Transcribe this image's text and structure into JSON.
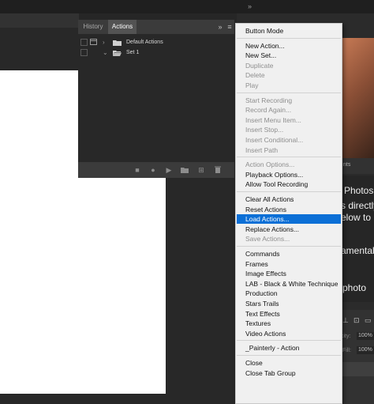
{
  "workspace": {
    "top_arrow": "»",
    "panel_bits": {
      "tab_fragment": "nts",
      "photos_text": "Photosh",
      "directly_text": "s directly",
      "below_text": "elow to b",
      "fundamental_text": "amental",
      "photo_text": "photo",
      "opacity_label": "city:",
      "opacity_value": "100%",
      "fill_label": "Fill:",
      "fill_value": "100%"
    }
  },
  "actions_panel": {
    "tabs": {
      "history": "History",
      "actions": "Actions"
    },
    "header_icons": {
      "collapse": "»",
      "menu": "≡"
    },
    "rows": [
      {
        "label": "Default Actions",
        "expanded": false
      },
      {
        "label": "Set 1",
        "expanded": true
      }
    ],
    "footer_icons": [
      "stop-icon",
      "record-icon",
      "play-icon",
      "folder-icon",
      "new-action-icon",
      "trash-icon"
    ]
  },
  "menu": {
    "groups": [
      [
        {
          "label": "Button Mode",
          "enabled": true
        }
      ],
      [
        {
          "label": "New Action...",
          "enabled": true
        },
        {
          "label": "New Set...",
          "enabled": true
        },
        {
          "label": "Duplicate",
          "enabled": false
        },
        {
          "label": "Delete",
          "enabled": false
        },
        {
          "label": "Play",
          "enabled": false
        }
      ],
      [
        {
          "label": "Start Recording",
          "enabled": false
        },
        {
          "label": "Record Again...",
          "enabled": false
        },
        {
          "label": "Insert Menu Item...",
          "enabled": false
        },
        {
          "label": "Insert Stop...",
          "enabled": false
        },
        {
          "label": "Insert Conditional...",
          "enabled": false
        },
        {
          "label": "Insert Path",
          "enabled": false
        }
      ],
      [
        {
          "label": "Action Options...",
          "enabled": false
        },
        {
          "label": "Playback Options...",
          "enabled": true
        },
        {
          "label": "Allow Tool Recording",
          "enabled": true
        }
      ],
      [
        {
          "label": "Clear All Actions",
          "enabled": true
        },
        {
          "label": "Reset Actions",
          "enabled": true
        },
        {
          "label": "Load Actions...",
          "enabled": true,
          "selected": true
        },
        {
          "label": "Replace Actions...",
          "enabled": true
        },
        {
          "label": "Save Actions...",
          "enabled": false
        }
      ],
      [
        {
          "label": "Commands",
          "enabled": true
        },
        {
          "label": "Frames",
          "enabled": true
        },
        {
          "label": "Image Effects",
          "enabled": true
        },
        {
          "label": "LAB - Black & White Technique",
          "enabled": true
        },
        {
          "label": "Production",
          "enabled": true
        },
        {
          "label": "Stars Trails",
          "enabled": true
        },
        {
          "label": "Text Effects",
          "enabled": true
        },
        {
          "label": "Textures",
          "enabled": true
        },
        {
          "label": "Video Actions",
          "enabled": true
        }
      ],
      [
        {
          "label": "_Painterly - Action",
          "enabled": true
        }
      ],
      [
        {
          "label": "Close",
          "enabled": true
        },
        {
          "label": "Close Tab Group",
          "enabled": true
        }
      ]
    ]
  }
}
